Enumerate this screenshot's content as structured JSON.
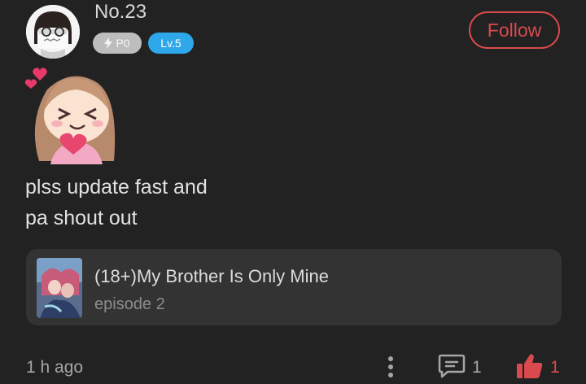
{
  "user": {
    "name": "No.23",
    "points_badge": "P0",
    "level_badge": "Lv.5"
  },
  "follow_label": "Follow",
  "comment": {
    "lines": [
      "plss update fast and",
      "pa shout out"
    ]
  },
  "linked_series": {
    "title": "(18+)My Brother Is Only Mine",
    "episode": "episode 2"
  },
  "footer": {
    "time": "1 h ago",
    "reply_count": "1",
    "like_count": "1"
  },
  "icons": {
    "more": "more-vertical-icon",
    "reply": "comment-icon",
    "like": "thumbs-up-icon",
    "bolt": "lightning-icon"
  },
  "colors": {
    "background": "#222222",
    "accent": "#d84a4d",
    "level_badge": "#2ea8ea",
    "points_badge": "#bdbdbd",
    "card": "#333333"
  }
}
